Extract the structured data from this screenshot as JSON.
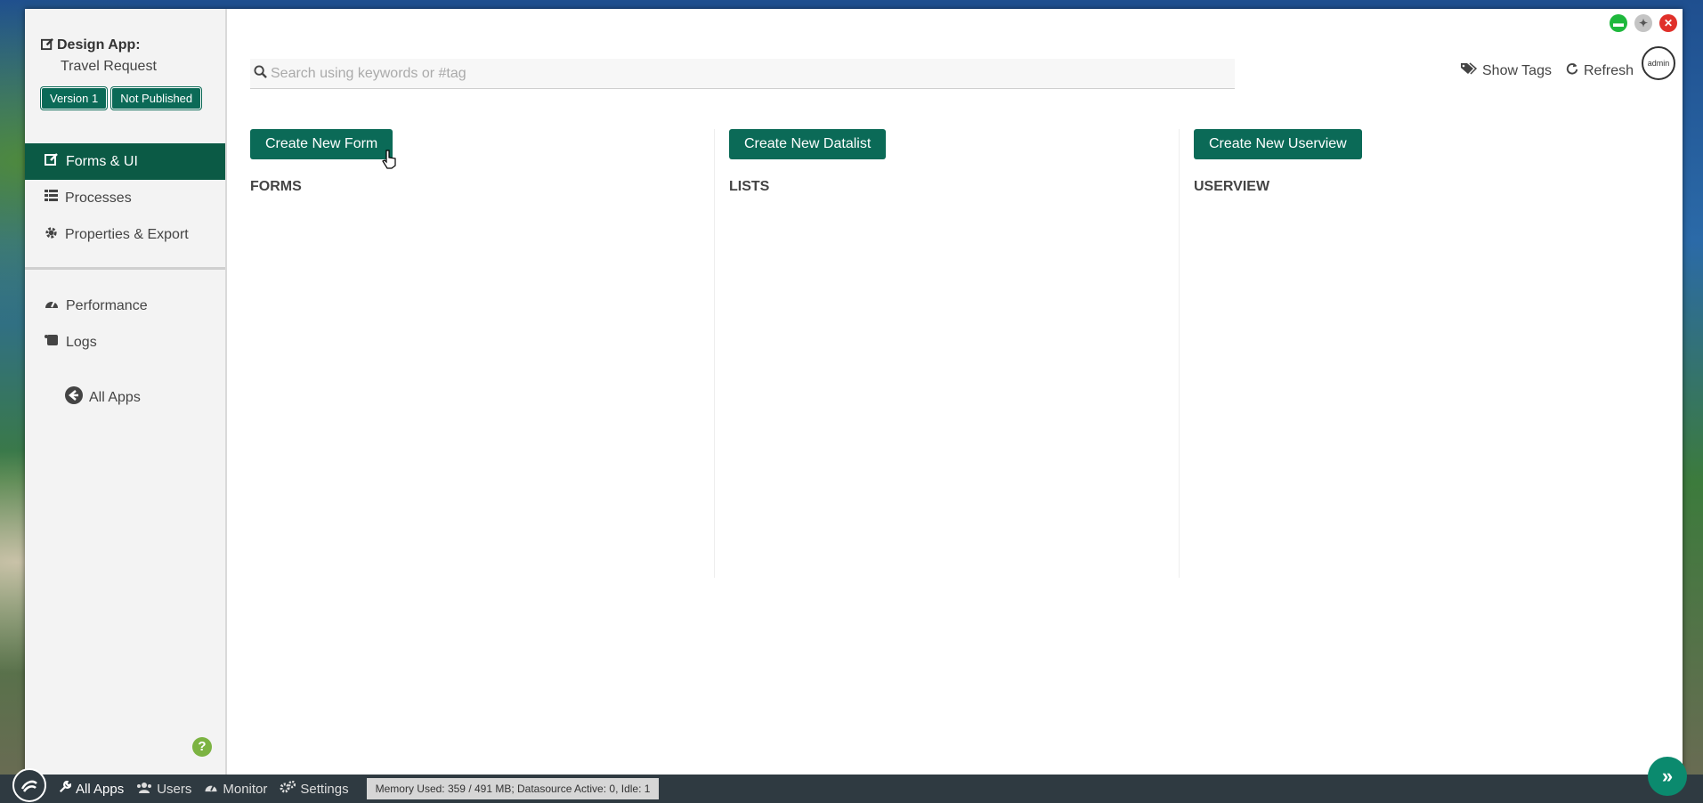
{
  "sidebar": {
    "design_label": "Design App:",
    "app_name": "Travel Request",
    "badges": [
      "Version 1",
      "Not Published"
    ],
    "nav": [
      {
        "label": "Forms & UI",
        "icon": "edit-icon",
        "active": true
      },
      {
        "label": "Processes",
        "icon": "list-icon",
        "active": false
      },
      {
        "label": "Properties & Export",
        "icon": "gear-icon",
        "active": false
      }
    ],
    "nav2": [
      {
        "label": "Performance",
        "icon": "dashboard-icon"
      },
      {
        "label": "Logs",
        "icon": "scroll-icon"
      }
    ],
    "back_label": "All Apps",
    "help": "?"
  },
  "search": {
    "placeholder": "Search using keywords or #tag",
    "value": ""
  },
  "top_links": {
    "show_tags": "Show Tags",
    "refresh": "Refresh"
  },
  "avatar": {
    "label": "admin"
  },
  "columns": [
    {
      "button": "Create New Form",
      "title": "FORMS"
    },
    {
      "button": "Create New Datalist",
      "title": "LISTS"
    },
    {
      "button": "Create New Userview",
      "title": "USERVIEW"
    }
  ],
  "bottom_bar": {
    "items": [
      {
        "label": "All Apps",
        "icon": "wrench-icon"
      },
      {
        "label": "Users",
        "icon": "users-icon"
      },
      {
        "label": "Monitor",
        "icon": "dashboard-icon"
      },
      {
        "label": "Settings",
        "icon": "gears-icon"
      }
    ],
    "memory": "Memory Used: 359 / 491 MB; Datasource Active: 0, Idle: 1"
  },
  "colors": {
    "brand": "#0b6a57",
    "active_nav": "#0b5a45",
    "bottom_bar": "#2f3a41"
  }
}
